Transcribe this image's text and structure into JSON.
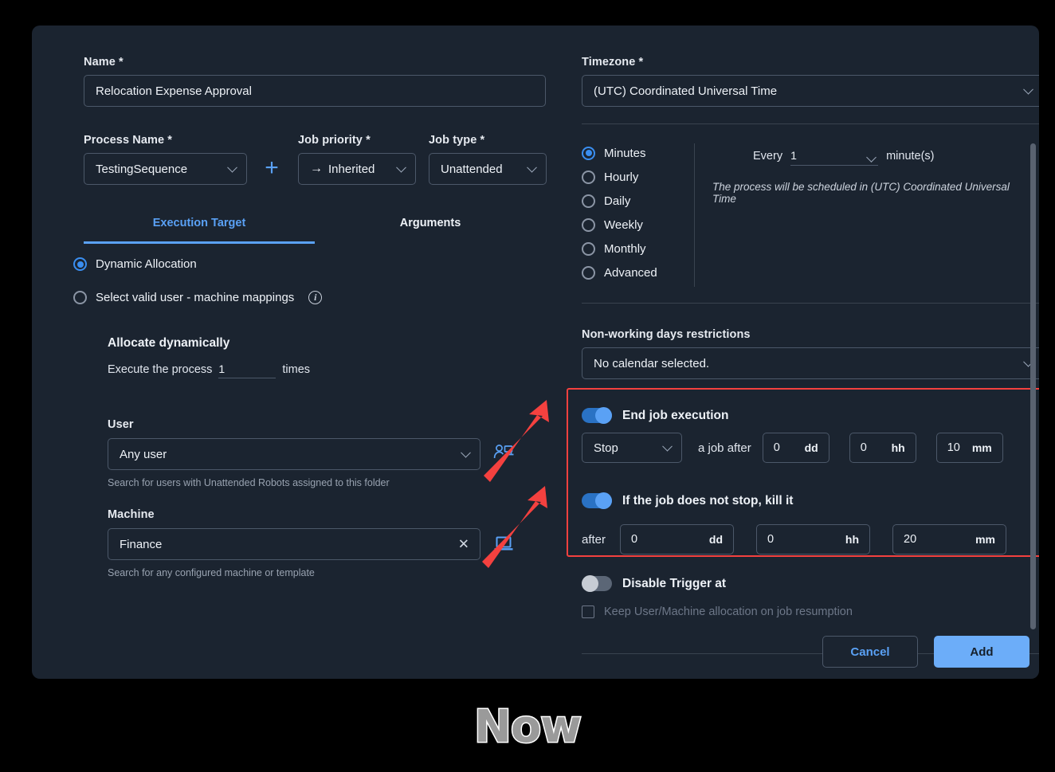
{
  "dialog": {
    "left": {
      "name_label": "Name *",
      "name_value": "Relocation Expense Approval",
      "process_label": "Process Name *",
      "process_value": "TestingSequence",
      "add_process_icon": "plus-icon",
      "priority_label": "Job priority *",
      "priority_value": "Inherited",
      "priority_prefix_icon": "arrow-right-icon",
      "jobtype_label": "Job type *",
      "jobtype_value": "Unattended",
      "tabs": [
        {
          "label": "Execution Target",
          "active": true
        },
        {
          "label": "Arguments",
          "active": false
        }
      ],
      "allocation_options": [
        {
          "label": "Dynamic Allocation",
          "selected": true
        },
        {
          "label": "Select valid user - machine mappings",
          "selected": false,
          "info_icon": "info-icon"
        }
      ],
      "allocate_title": "Allocate dynamically",
      "execute_prefix": "Execute the process",
      "execute_times_value": "1",
      "execute_suffix": "times",
      "user_label": "User",
      "user_value": "Any user",
      "user_hint": "Search for users with Unattended Robots assigned to this folder",
      "user_icon": "user-machine-icon",
      "machine_label": "Machine",
      "machine_value": "Finance",
      "machine_clear_icon": "close-icon",
      "machine_hint": "Search for any configured machine or template",
      "machine_icon": "laptop-icon"
    },
    "right": {
      "timezone_label": "Timezone *",
      "timezone_value": "(UTC) Coordinated Universal Time",
      "frequency_options": [
        {
          "label": "Minutes",
          "selected": true
        },
        {
          "label": "Hourly",
          "selected": false
        },
        {
          "label": "Daily",
          "selected": false
        },
        {
          "label": "Weekly",
          "selected": false
        },
        {
          "label": "Monthly",
          "selected": false
        },
        {
          "label": "Advanced",
          "selected": false
        }
      ],
      "every_prefix": "Every",
      "every_value": "1",
      "every_suffix": "minute(s)",
      "schedule_note": "The process will be scheduled in (UTC) Coordinated Universal Time",
      "nonworking_label": "Non-working days restrictions",
      "nonworking_value": "No calendar selected.",
      "end_job_toggle_label": "End job execution",
      "end_job_toggle_on": true,
      "end_action_value": "Stop",
      "end_middle_text": "a job after",
      "end_dd_value": "0",
      "end_dd_unit": "dd",
      "end_hh_value": "0",
      "end_hh_unit": "hh",
      "end_mm_value": "10",
      "end_mm_unit": "mm",
      "kill_toggle_label": "If the job does not stop, kill it",
      "kill_toggle_on": true,
      "kill_prefix": "after",
      "kill_dd_value": "0",
      "kill_dd_unit": "dd",
      "kill_hh_value": "0",
      "kill_hh_unit": "hh",
      "kill_mm_value": "20",
      "kill_mm_unit": "mm",
      "disable_trigger_label": "Disable Trigger at",
      "disable_trigger_on": false,
      "keep_allocation_label": "Keep User/Machine allocation on job resumption"
    },
    "footer": {
      "cancel_label": "Cancel",
      "add_label": "Add"
    }
  },
  "watermark": {
    "text": "Now"
  },
  "colors": {
    "accent_blue": "#5aa1f5",
    "highlight_red": "#f4413f",
    "dialog_bg": "#1b2430",
    "page_bg": "#000000",
    "border": "#4c5869"
  }
}
